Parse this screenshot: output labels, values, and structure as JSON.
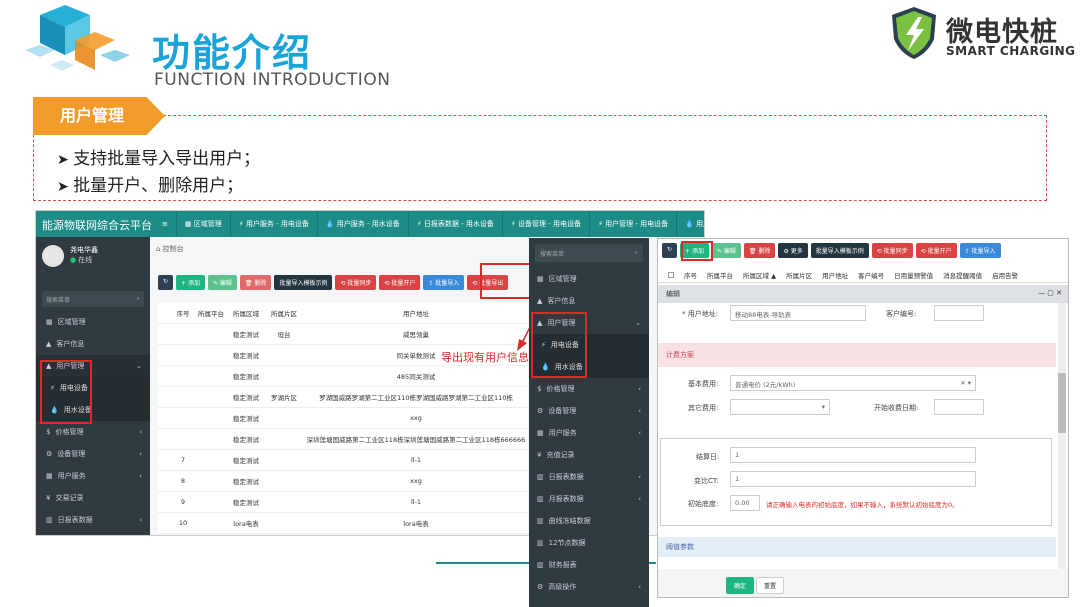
{
  "header": {
    "title_cn": "功能介绍",
    "title_en": "FUNCTION INTRODUCTION",
    "brand_cn": "微电快桩",
    "brand_en": "SMART CHARGING"
  },
  "section": {
    "tab": "用户管理",
    "bullets": [
      "支持批量导入导出用户；",
      "批量开户、删除用户；"
    ]
  },
  "annotation": "导出现有用户信息",
  "s1": {
    "app_title": "能源物联网综合云平台",
    "tabs": [
      "≡",
      "▦ 区域管理",
      "⚡ 用户服务 - 用电设备",
      "💧 用户服务 - 用水设备",
      "⚡ 日报表数据 - 用水设备",
      "⚡ 设备管理 - 用电设备",
      "⚡ 用户管理 - 用电设备",
      "💧 用户管理 -"
    ],
    "user": {
      "name": "尧电华鑫",
      "status": "在线"
    },
    "search": "搜索菜单",
    "menu": [
      {
        "label": "区域管理",
        "icon": "▦"
      },
      {
        "label": "客户信息",
        "icon": "▲"
      },
      {
        "label": "用户管理",
        "icon": "▲",
        "arrow": "⌄"
      },
      {
        "label": "用电设备",
        "icon": "⚡",
        "sub": true
      },
      {
        "label": "用水设备",
        "icon": "💧",
        "sub": true
      },
      {
        "label": "价格管理",
        "icon": "$",
        "arrow": "‹"
      },
      {
        "label": "设备管理",
        "icon": "⚙",
        "arrow": "‹"
      },
      {
        "label": "用户服务",
        "icon": "▦",
        "arrow": "‹"
      },
      {
        "label": "交易记录",
        "icon": "¥",
        "arrow": ""
      },
      {
        "label": "日报表数据",
        "icon": "▥",
        "arrow": "‹"
      }
    ],
    "crumb": "控制台",
    "toolbar": [
      "↻",
      "+ 添加",
      "✎ 编辑",
      "🗑 删除",
      "批量导入模板示例",
      "⟲ 批量同步",
      "⟲ 批量开户",
      "⇪ 批量导入",
      "⟲ 批量导出"
    ],
    "columns": [
      "",
      "序号",
      "所属平台",
      "所属区域",
      "所属片区",
      "用户地址"
    ],
    "rows": [
      [
        "",
        "",
        "",
        "稳定测试",
        "坦台",
        "威思领巢"
      ],
      [
        "",
        "",
        "",
        "稳定测试",
        "",
        "同关单数测试"
      ],
      [
        "",
        "",
        "",
        "稳定测试",
        "",
        "485同关测试"
      ],
      [
        "",
        "",
        "",
        "稳定测试",
        "罗湖片区",
        "罗湖国威路罗湖第二工业区110栋罗湖国威路罗湖第二工业区110栋"
      ],
      [
        "",
        "",
        "",
        "稳定测试",
        "",
        "xxg"
      ],
      [
        "",
        "",
        "",
        "稳定测试",
        "",
        "深圳莲塘国威路第二工业区118栋深圳莲塘国威路第二工业区118栋666666"
      ],
      [
        "",
        "7",
        "",
        "稳定测试",
        "",
        "ll-1"
      ],
      [
        "",
        "8",
        "",
        "稳定测试",
        "",
        "xxg"
      ],
      [
        "",
        "9",
        "",
        "稳定测试",
        "",
        "ll-1"
      ],
      [
        "",
        "10",
        "",
        "lora电表",
        "",
        "lora电表"
      ]
    ]
  },
  "s2": {
    "search": "搜索菜单",
    "menu": [
      {
        "label": "区域管理",
        "icon": "▦"
      },
      {
        "label": "客户信息",
        "icon": "▲"
      },
      {
        "label": "用户管理",
        "icon": "▲",
        "arrow": "⌄"
      },
      {
        "label": "用电设备",
        "icon": "⚡",
        "sub": true
      },
      {
        "label": "用水设备",
        "icon": "💧",
        "sub": true
      },
      {
        "label": "价格管理",
        "icon": "$",
        "arrow": "‹"
      },
      {
        "label": "设备管理",
        "icon": "⚙",
        "arrow": "‹"
      },
      {
        "label": "用户服务",
        "icon": "▦",
        "arrow": "‹"
      },
      {
        "label": "充值记录",
        "icon": "¥",
        "arrow": ""
      },
      {
        "label": "日报表数据",
        "icon": "▥",
        "arrow": "‹"
      },
      {
        "label": "月报表数据",
        "icon": "▥",
        "arrow": "‹"
      },
      {
        "label": "曲线冻结数据",
        "icon": "▥",
        "arrow": ""
      },
      {
        "label": "12节点数据",
        "icon": "▥",
        "arrow": ""
      },
      {
        "label": "财务报表",
        "icon": "▥",
        "arrow": ""
      },
      {
        "label": "高级操作",
        "icon": "⚙",
        "arrow": "‹"
      }
    ]
  },
  "s3": {
    "toolbar": [
      "↻",
      "+ 添加",
      "✎ 编辑",
      "🗑 删除",
      "⚙ 更多",
      "批量导入模板示例",
      "⟲ 批量同步",
      "⟲ 批量开户",
      "⇪ 批量导入"
    ],
    "columns": [
      "序号",
      "所属平台",
      "所属区域 ▲",
      "所属片区",
      "用户地址",
      "客户编号",
      "日用量预警值",
      "消息提醒阈值",
      "启用告警"
    ],
    "modal_title": "编辑",
    "win_ctrl": "— ▢ ✕",
    "fields": {
      "addr_label": "* 用户地址:",
      "addr_value": "移动88电表-导轨表",
      "custno_label": "客户编号:",
      "plan_title": "计费方案",
      "basic_label": "基本费用:",
      "basic_value": "普通电价 (2元/kWh)",
      "basic_ctrl": "✕ ▾",
      "other_label": "其它费用:",
      "other_ctrl": "▾",
      "start_label": "开始收费日期:",
      "settle_label": "结算日:",
      "settle_value": "1",
      "ct_label": "变比CT:",
      "ct_value": "1",
      "init_label": "初始底度:",
      "init_value": "0.00",
      "init_hint": "请正确输入电表的初始底度，如果不输入，系统默认初始底度为0。",
      "threshold_title": "阈值参数"
    },
    "ok": "确定",
    "reset": "重置"
  }
}
